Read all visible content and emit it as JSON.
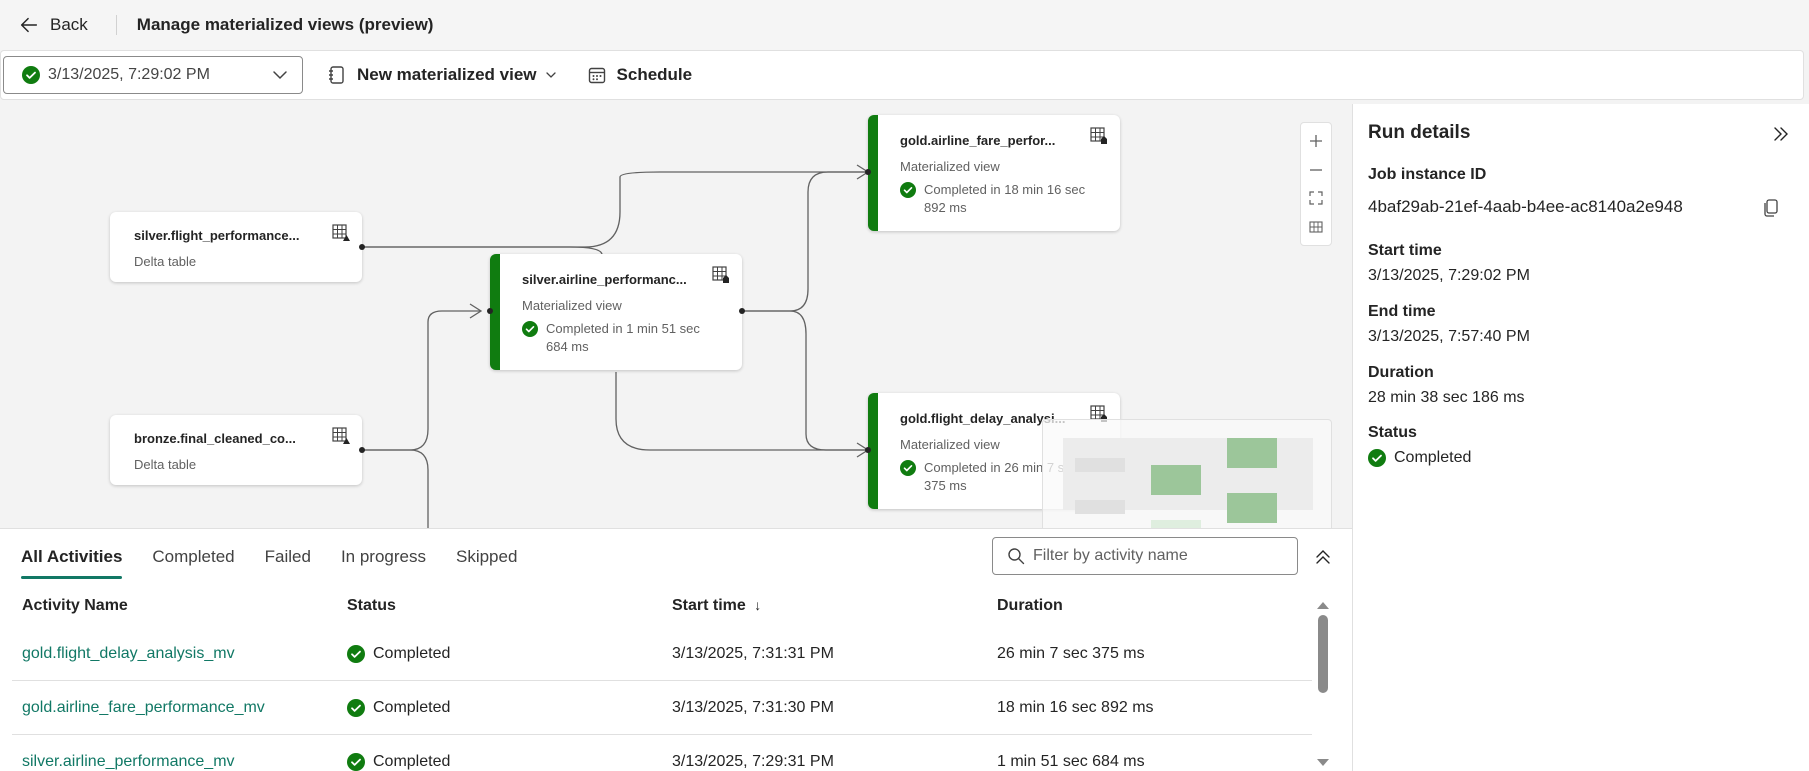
{
  "header": {
    "back_label": "Back",
    "title": "Manage materialized views (preview)"
  },
  "toolbar": {
    "run_selected": "3/13/2025, 7:29:02 PM",
    "new_mv_label": "New materialized view",
    "schedule_label": "Schedule"
  },
  "graph": {
    "nodes": [
      {
        "title": "silver.flight_performance...",
        "type": "Delta table"
      },
      {
        "title": "bronze.final_cleaned_co...",
        "type": "Delta table"
      },
      {
        "title": "silver.airline_performanc...",
        "type": "Materialized view",
        "status": "Completed in 1 min 51 sec 684 ms"
      },
      {
        "title": "gold.airline_fare_perfor...",
        "type": "Materialized view",
        "status": "Completed in 18 min 16 sec 892 ms"
      },
      {
        "title": "gold.flight_delay_analysi...",
        "type": "Materialized view",
        "status": "Completed in 26 min 7 sec 375 ms"
      }
    ]
  },
  "details": {
    "title": "Run details",
    "job_label": "Job instance ID",
    "job_id": "4baf29ab-21ef-4aab-b4ee-ac8140a2e948",
    "start_label": "Start time",
    "start_value": "3/13/2025, 7:29:02 PM",
    "end_label": "End time",
    "end_value": "3/13/2025, 7:57:40 PM",
    "duration_label": "Duration",
    "duration_value": "28 min 38 sec 186 ms",
    "status_label": "Status",
    "status_value": "Completed"
  },
  "activities": {
    "tabs": [
      "All Activities",
      "Completed",
      "Failed",
      "In progress",
      "Skipped"
    ],
    "filter_placeholder": "Filter by activity name",
    "columns": [
      "Activity Name",
      "Status",
      "Start time",
      "Duration"
    ],
    "sort_indicator": "↓",
    "rows": [
      {
        "name": "gold.flight_delay_analysis_mv",
        "status": "Completed",
        "start": "3/13/2025, 7:31:31 PM",
        "duration": "26 min 7 sec 375 ms"
      },
      {
        "name": "gold.airline_fare_performance_mv",
        "status": "Completed",
        "start": "3/13/2025, 7:31:30 PM",
        "duration": "18 min 16 sec 892 ms"
      },
      {
        "name": "silver.airline_performance_mv",
        "status": "Completed",
        "start": "3/13/2025, 7:29:31 PM",
        "duration": "1 min 51 sec 684 ms"
      }
    ]
  },
  "colors": {
    "success": "#107c10",
    "link": "#117865"
  }
}
